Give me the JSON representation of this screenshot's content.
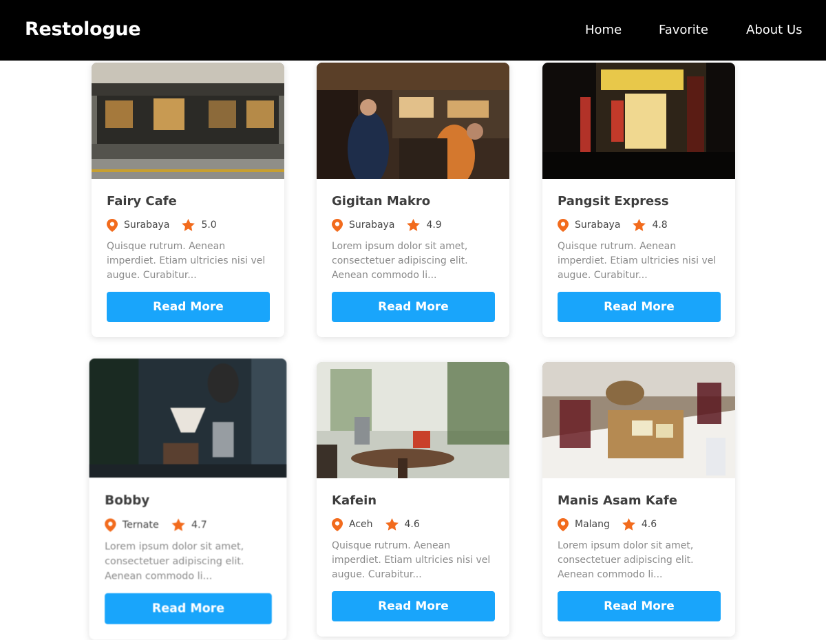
{
  "header": {
    "brand": "Restologue",
    "nav": [
      {
        "label": "Home"
      },
      {
        "label": "Favorite"
      },
      {
        "label": "About Us"
      }
    ]
  },
  "colors": {
    "navbar": "#000000",
    "accent_button": "#19a5fb",
    "icon_orange": "#f26b1d"
  },
  "icons": {
    "location": "location-pin-icon",
    "rating": "star-icon"
  },
  "restaurants": [
    {
      "name": "Fairy Cafe",
      "city": "Surabaya",
      "rating": "5.0",
      "description": "Quisque rutrum. Aenean imperdiet. Etiam ultricies nisi vel augue. Curabitur...",
      "button": "Read More"
    },
    {
      "name": "Gigitan Makro",
      "city": "Surabaya",
      "rating": "4.9",
      "description": "Lorem ipsum dolor sit amet, consectetuer adipiscing elit. Aenean commodo li...",
      "button": "Read More"
    },
    {
      "name": "Pangsit Express",
      "city": "Surabaya",
      "rating": "4.8",
      "description": "Quisque rutrum. Aenean imperdiet. Etiam ultricies nisi vel augue. Curabitur...",
      "button": "Read More"
    },
    {
      "name": "Bobby",
      "city": "Ternate",
      "rating": "4.7",
      "description": "Lorem ipsum dolor sit amet, consectetuer adipiscing elit. Aenean commodo li...",
      "button": "Read More"
    },
    {
      "name": "Kafein",
      "city": "Aceh",
      "rating": "4.6",
      "description": "Quisque rutrum. Aenean imperdiet. Etiam ultricies nisi vel augue. Curabitur...",
      "button": "Read More"
    },
    {
      "name": "Manis Asam Kafe",
      "city": "Malang",
      "rating": "4.6",
      "description": "Lorem ipsum dolor sit amet, consectetuer adipiscing elit. Aenean commodo li...",
      "button": "Read More"
    }
  ]
}
